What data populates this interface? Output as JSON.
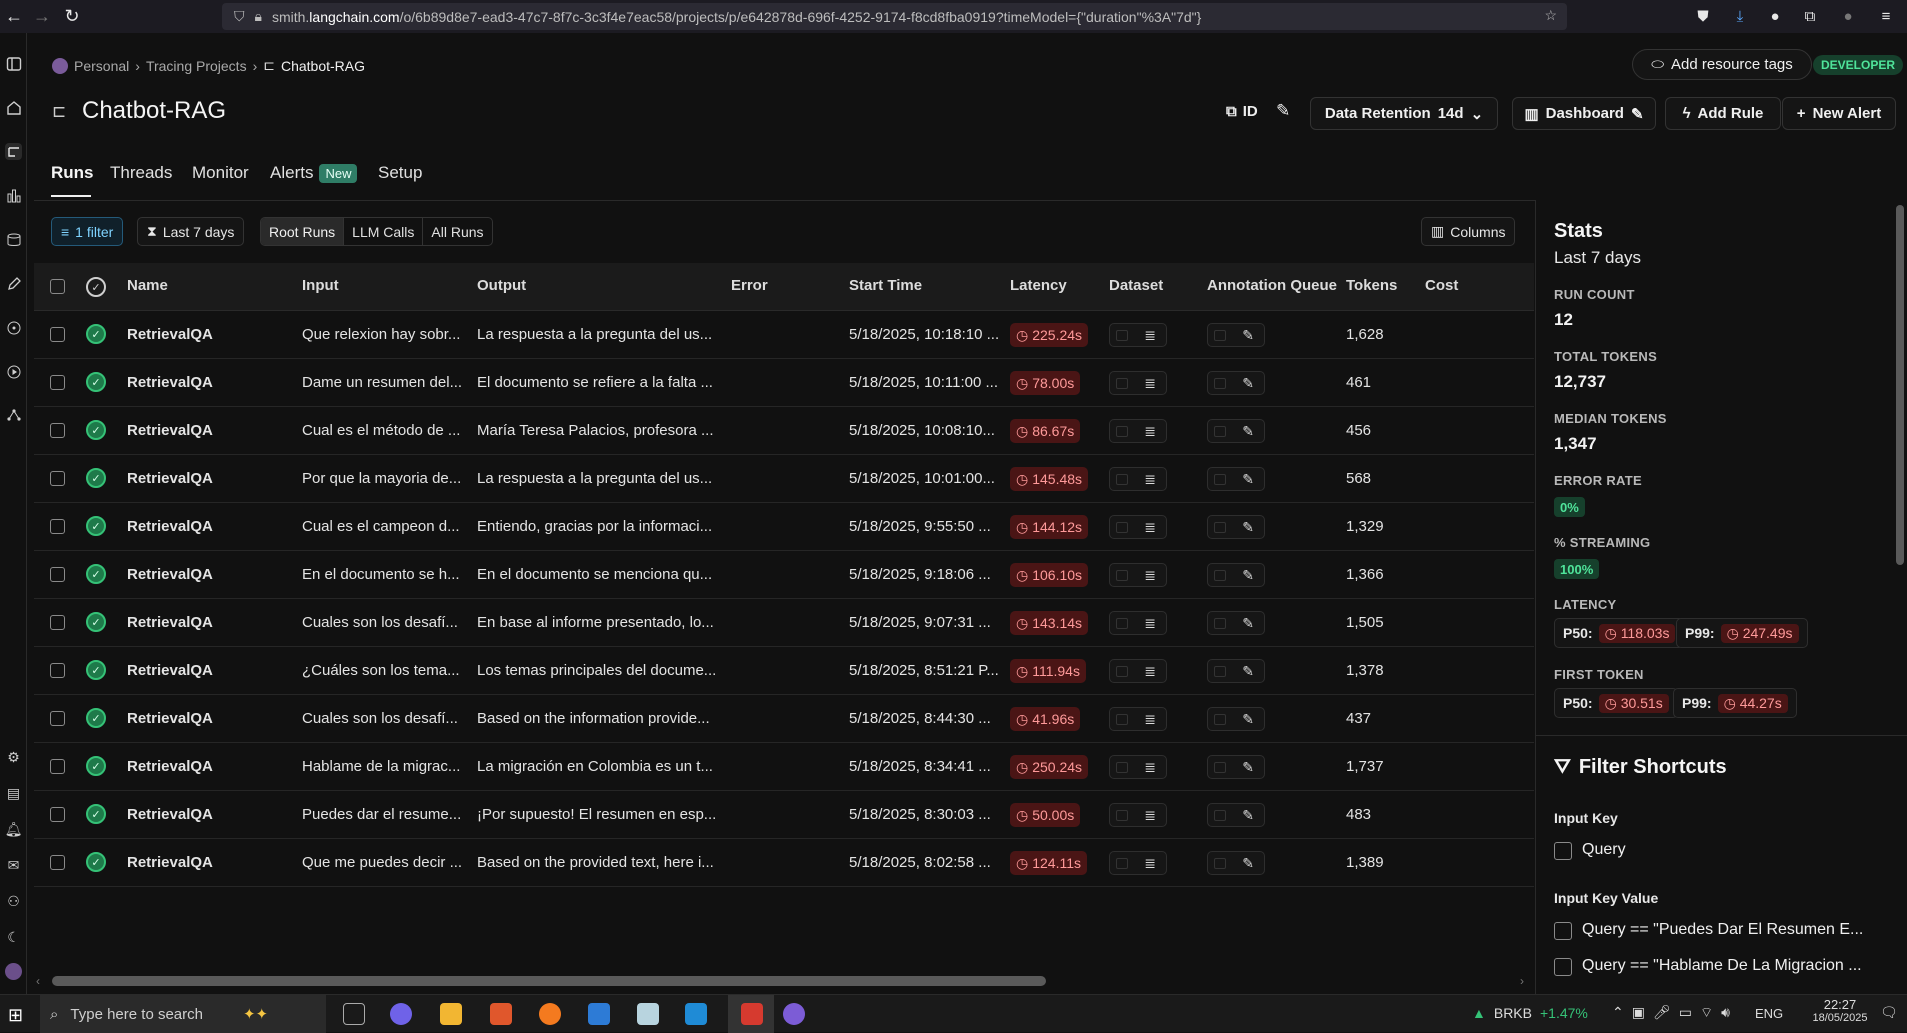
{
  "browser": {
    "url_prefix": "smith.",
    "url_host": "langchain.com",
    "url_path": "/o/6b89d8e7-ead3-47c7-8f7c-3c3f4e7eac58/projects/p/e642878d-696f-4252-9174-f8cd8fba0919?timeModel={\"duration\"%3A\"7d\"}"
  },
  "breadcrumb": {
    "personal": "Personal",
    "tracing": "Tracing Projects",
    "current": "Chatbot-RAG"
  },
  "header": {
    "add_resource_tags": "Add resource tags",
    "developer_badge": "DEVELOPER",
    "project_title": "Chatbot-RAG",
    "id_label": "ID",
    "data_retention_label": "Data Retention",
    "data_retention_value": "14d",
    "dashboard": "Dashboard",
    "add_rule": "Add Rule",
    "new_alert": "New Alert"
  },
  "tabs": {
    "runs": "Runs",
    "threads": "Threads",
    "monitor": "Monitor",
    "alerts": "Alerts",
    "alerts_badge": "New",
    "setup": "Setup"
  },
  "filters": {
    "filter_count": "1 filter",
    "time_range": "Last 7 days",
    "root_runs": "Root Runs",
    "llm_calls": "LLM Calls",
    "all_runs": "All Runs",
    "columns": "Columns"
  },
  "table": {
    "headers": {
      "name": "Name",
      "input": "Input",
      "output": "Output",
      "error": "Error",
      "start_time": "Start Time",
      "latency": "Latency",
      "dataset": "Dataset",
      "annotation_queue": "Annotation Queue",
      "tokens": "Tokens",
      "cost": "Cost"
    },
    "rows": [
      {
        "name": "RetrievalQA",
        "input": "Que relexion hay sobr...",
        "output": "La respuesta a la pregunta del us...",
        "start": "5/18/2025, 10:18:10 ...",
        "latency": "225.24s",
        "tokens": "1,628"
      },
      {
        "name": "RetrievalQA",
        "input": "Dame un resumen del...",
        "output": "El documento se refiere a la falta ...",
        "start": "5/18/2025, 10:11:00 ...",
        "latency": "78.00s",
        "tokens": "461"
      },
      {
        "name": "RetrievalQA",
        "input": "Cual es el método de ...",
        "output": "María Teresa Palacios, profesora ...",
        "start": "5/18/2025, 10:08:10...",
        "latency": "86.67s",
        "tokens": "456"
      },
      {
        "name": "RetrievalQA",
        "input": "Por que la mayoria de...",
        "output": "La respuesta a la pregunta del us...",
        "start": "5/18/2025, 10:01:00...",
        "latency": "145.48s",
        "tokens": "568"
      },
      {
        "name": "RetrievalQA",
        "input": "Cual es el campeon d...",
        "output": "Entiendo, gracias por la informaci...",
        "start": "5/18/2025, 9:55:50 ...",
        "latency": "144.12s",
        "tokens": "1,329"
      },
      {
        "name": "RetrievalQA",
        "input": "En el documento se h...",
        "output": "En el documento se menciona qu...",
        "start": "5/18/2025, 9:18:06 ...",
        "latency": "106.10s",
        "tokens": "1,366"
      },
      {
        "name": "RetrievalQA",
        "input": "Cuales son los desafí...",
        "output": "En base al informe presentado, lo...",
        "start": "5/18/2025, 9:07:31 ...",
        "latency": "143.14s",
        "tokens": "1,505"
      },
      {
        "name": "RetrievalQA",
        "input": "¿Cuáles son los tema...",
        "output": "Los temas principales del docume...",
        "start": "5/18/2025, 8:51:21 P...",
        "latency": "111.94s",
        "tokens": "1,378"
      },
      {
        "name": "RetrievalQA",
        "input": "Cuales son los desafí...",
        "output": "Based on the information provide...",
        "start": "5/18/2025, 8:44:30 ...",
        "latency": "41.96s",
        "tokens": "437"
      },
      {
        "name": "RetrievalQA",
        "input": "Hablame de la migrac...",
        "output": "La migración en Colombia es un t...",
        "start": "5/18/2025, 8:34:41 ...",
        "latency": "250.24s",
        "tokens": "1,737"
      },
      {
        "name": "RetrievalQA",
        "input": "Puedes dar el resume...",
        "output": "¡Por supuesto! El resumen en esp...",
        "start": "5/18/2025, 8:30:03 ...",
        "latency": "50.00s",
        "tokens": "483"
      },
      {
        "name": "RetrievalQA",
        "input": "Que me puedes decir ...",
        "output": "Based on the provided text, here i...",
        "start": "5/18/2025, 8:02:58 ...",
        "latency": "124.11s",
        "tokens": "1,389"
      }
    ]
  },
  "stats": {
    "title": "Stats",
    "subtitle": "Last 7 days",
    "run_count_label": "RUN COUNT",
    "run_count": "12",
    "total_tokens_label": "TOTAL TOKENS",
    "total_tokens": "12,737",
    "median_tokens_label": "MEDIAN TOKENS",
    "median_tokens": "1,347",
    "error_rate_label": "ERROR RATE",
    "error_rate": "0%",
    "streaming_label": "% STREAMING",
    "streaming": "100%",
    "latency_label": "LATENCY",
    "p50_label": "P50:",
    "p99_label": "P99:",
    "latency_p50": "118.03s",
    "latency_p99": "247.49s",
    "first_token_label": "FIRST TOKEN",
    "first_token_p50": "30.51s",
    "first_token_p99": "44.27s"
  },
  "filter_shortcuts": {
    "title": "Filter Shortcuts",
    "input_key_label": "Input Key",
    "query": "Query",
    "input_key_value_label": "Input Key Value",
    "value1": "Query == \"Puedes Dar El Resumen E...",
    "value2": "Query == \"Hablame De La Migracion ..."
  },
  "taskbar": {
    "search_placeholder": "Type here to search",
    "ticker": "BRKB",
    "ticker_change": "+1.47%",
    "lang": "ENG",
    "time": "22:27",
    "date": "18/05/2025"
  },
  "colors": {
    "accent_green": "#35c277",
    "latency_red": "#ff9a9a",
    "new_badge": "#2f7d66"
  }
}
